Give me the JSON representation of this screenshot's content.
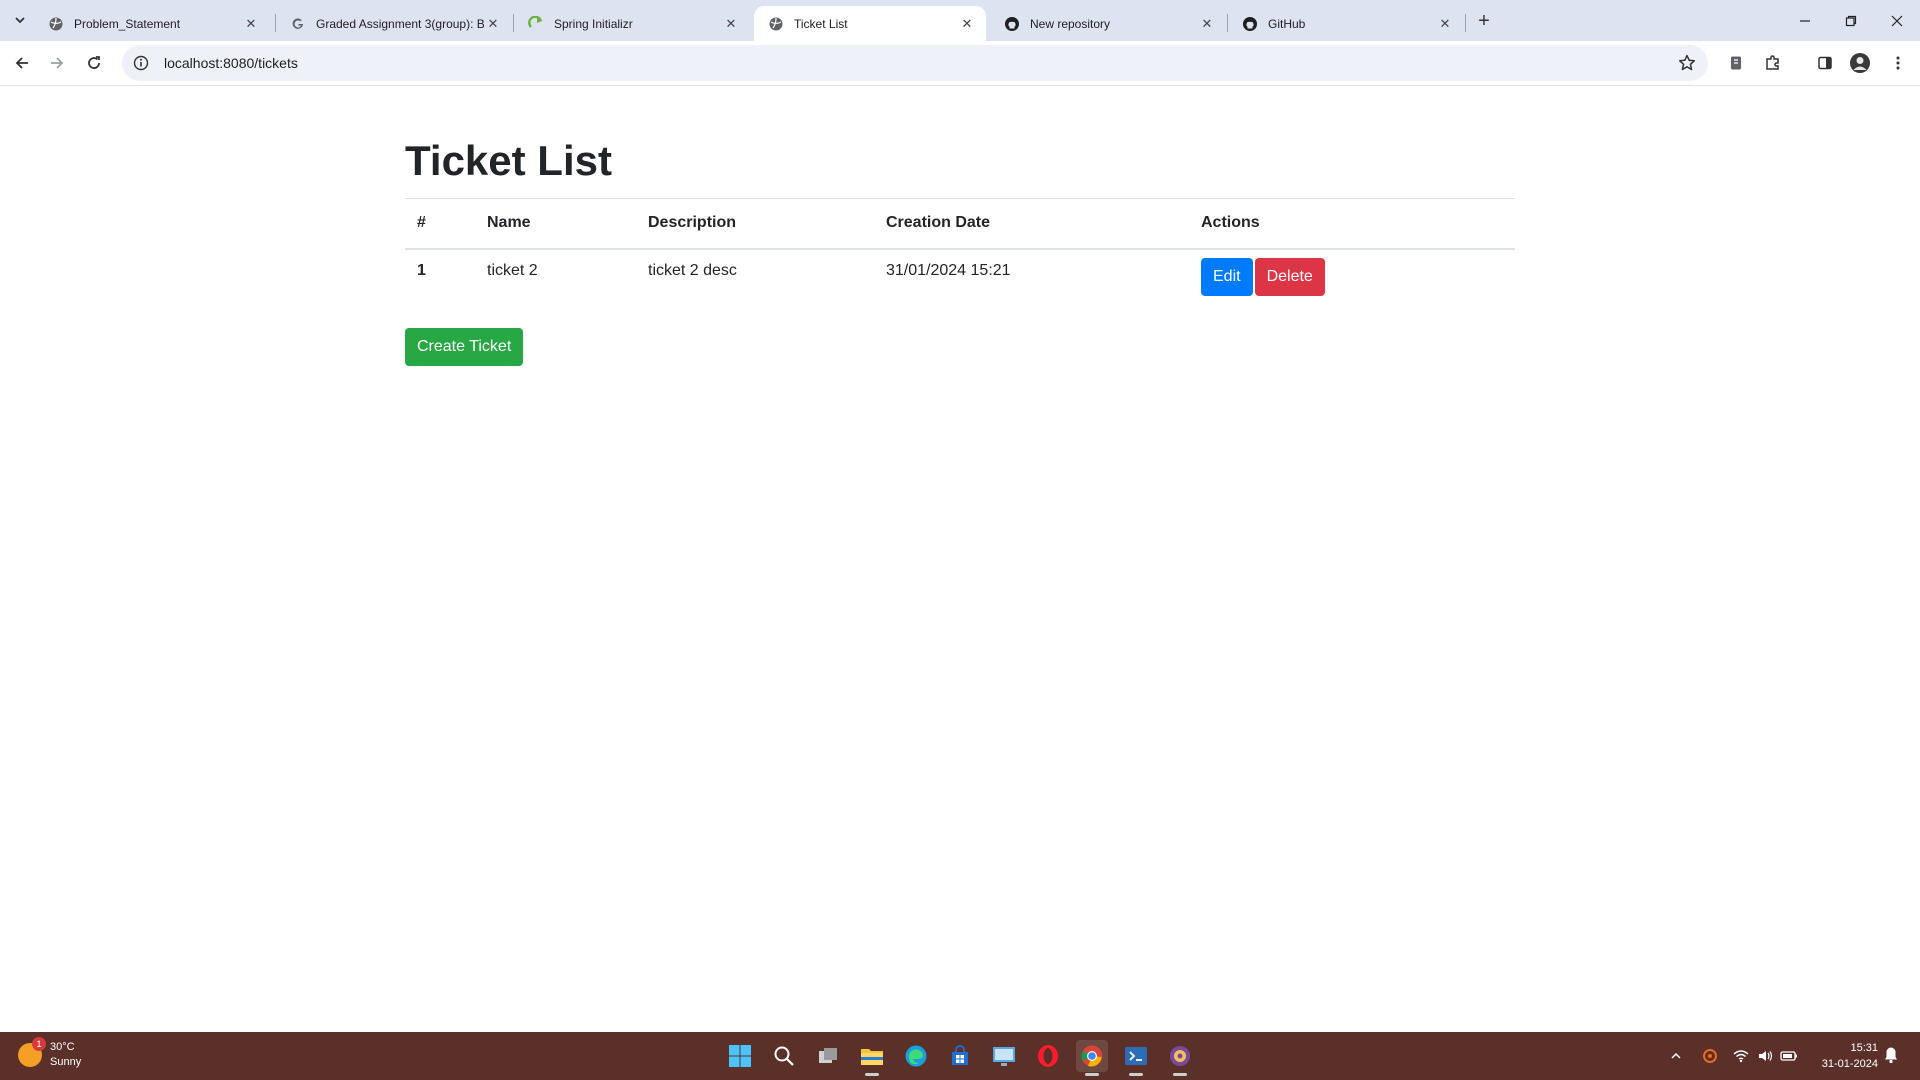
{
  "browser": {
    "tabs": [
      {
        "title": "Problem_Statement",
        "active": false,
        "favicon": "globe-icon"
      },
      {
        "title": "Graded Assignment 3(group): B",
        "active": false,
        "favicon": "google-icon"
      },
      {
        "title": "Spring Initializr",
        "active": false,
        "favicon": "spring-icon"
      },
      {
        "title": "Ticket List",
        "active": true,
        "favicon": "globe-icon"
      },
      {
        "title": "New repository",
        "active": false,
        "favicon": "github-icon"
      },
      {
        "title": "GitHub",
        "active": false,
        "favicon": "github-icon"
      }
    ],
    "address": "localhost:8080/tickets"
  },
  "page": {
    "title": "Ticket List",
    "table": {
      "headers": [
        "#",
        "Name",
        "Description",
        "Creation Date",
        "Actions"
      ],
      "rows": [
        {
          "num": "1",
          "name": "ticket 2",
          "description": "ticket 2 desc",
          "date": "31/01/2024 15:21"
        }
      ]
    },
    "buttons": {
      "edit": "Edit",
      "delete": "Delete",
      "create": "Create Ticket"
    }
  },
  "taskbar": {
    "weather": {
      "temp": "30°C",
      "condition": "Sunny",
      "badge": "1"
    },
    "clock": {
      "time": "15:31",
      "date": "31-01-2024"
    }
  },
  "colors": {
    "primary": "#007bff",
    "danger": "#dc3545",
    "success": "#28a745",
    "taskbar": "#5a3028",
    "tabstrip": "#dde3f0"
  }
}
